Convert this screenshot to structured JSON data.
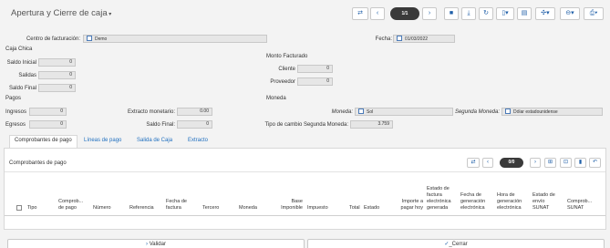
{
  "header": {
    "title": "Apertura y Cierre de caja",
    "pager": "1/1"
  },
  "form": {
    "centro_label": "Centro de facturación:",
    "centro_value": "Demo",
    "fecha_label": "Fecha:",
    "fecha_value": "01/03/2022",
    "caja_chica": "Caja Chica",
    "saldo_inicial_label": "Saldo Inicial",
    "saldo_inicial_value": "0",
    "salidas_label": "Salidas",
    "salidas_value": "0",
    "saldo_final_label": "Saldo Final",
    "saldo_final_value": "0",
    "monto_facturado": "Monto Facturado",
    "cliente_label": "Cliente",
    "cliente_value": "0",
    "proveedor_label": "Proveedor",
    "proveedor_value": "0",
    "pagos": "Pagos",
    "moneda_section": "Moneda",
    "ingresos_label": "Ingresos",
    "ingresos_value": "0",
    "egresos_label": "Egresos",
    "egresos_value": "0",
    "extracto_label": "Extracto monetario:",
    "extracto_value": "0.00",
    "saldo_final2_label": "Saldo Final:",
    "saldo_final2_value": "0",
    "moneda_label": "Moneda:",
    "moneda_value": "Sol",
    "segunda_moneda_label": "Segunda Moneda:",
    "segunda_moneda_value": "Dólar estadounidense",
    "tipo_cambio_label": "Tipo de cambio Segunda Moneda:",
    "tipo_cambio_value": "3.759"
  },
  "tabs": [
    "Comprobantes de pago",
    "Líneas de pago",
    "Salida de Caja",
    "Extracto"
  ],
  "subgrid": {
    "title": "Comprobantes de pago",
    "pager": "0/0",
    "columns": {
      "tipo": "Tipo",
      "comprobante": "Comprob...\nde pago",
      "numero": "Número",
      "referencia": "Referencia",
      "fecha_factura": "Fecha de\nfactura",
      "tercero": "Tercero",
      "moneda": "Moneda",
      "base": "Base\nImponible",
      "impuesto": "Impuesto",
      "total": "Total",
      "estado": "Estado",
      "importe": "Importe a\npagar hoy",
      "estado_fe": "Estado de\nfactura\nelectrónica\ngenerada",
      "fecha_gen": "Fecha de\ngeneración\nelectrónica",
      "hora_gen": "Hora de\ngeneración\nelectrónica",
      "estado_envio": "Estado de\nenvío\nSUNAT",
      "comprob2": "Comprob...\nSUNAT"
    }
  },
  "footer": {
    "validar": "Validar",
    "cerrar": "_Cerrar"
  }
}
